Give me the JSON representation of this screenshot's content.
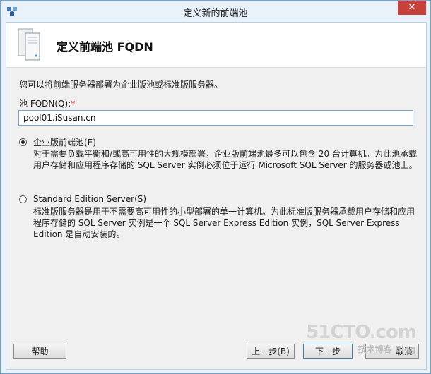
{
  "window": {
    "title": "定义新的前端池",
    "close_symbol": "✕",
    "app_icon": "topology-builder-icon"
  },
  "header": {
    "title": "定义前端池 FQDN",
    "icon": "server-stack-icon"
  },
  "form": {
    "description": "您可以将前端服务器部署为企业版池或标准版服务器。",
    "pool_label": "池 FQDN(Q):",
    "required_mark": "*",
    "fqdn_value": "pool01.iSusan.cn"
  },
  "options": [
    {
      "label": "企业版前端池(E)",
      "selected": true,
      "description": "对于需要负载平衡和/或高可用性的大规模部署，企业版前端池最多可以包含 20 台计算机。为此池承载用户存储和应用程序存储的 SQL Server 实例必须位于运行 Microsoft SQL Server 的服务器或池上。"
    },
    {
      "label": "Standard Edition Server(S)",
      "selected": false,
      "description": "标准版服务器是用于不需要高可用性的小型部署的单一计算机。为此标准版服务器承载用户存储和应用程序存储的 SQL Server 实例是一个 SQL Server Express Edition 实例，SQL Server Express Edition 是自动安装的。"
    }
  ],
  "buttons": {
    "help": "帮助",
    "back": "上一步(B)",
    "next": "下一步",
    "cancel": "取消"
  },
  "watermark": {
    "line1": "51CTO.com",
    "line2": "技术博客 Blog"
  }
}
